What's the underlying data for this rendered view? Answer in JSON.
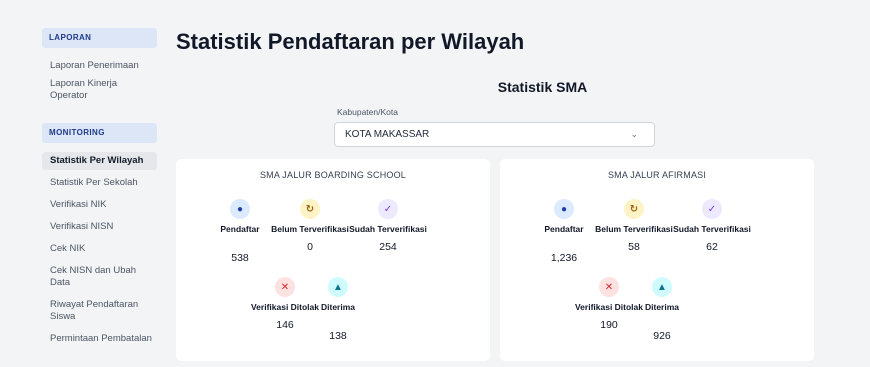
{
  "sidebar": {
    "laporan_title": "LAPORAN",
    "laporan_items": [
      "Laporan Penerimaan",
      "Laporan Kinerja Operator"
    ],
    "monitoring_title": "MONITORING",
    "monitoring_items": [
      "Statistik Per Wilayah",
      "Statistik Per Sekolah",
      "Verifikasi NIK",
      "Verifikasi NISN",
      "Cek NIK",
      "Cek NISN dan Ubah Data",
      "Riwayat Pendaftaran Siswa",
      "Permintaan Pembatalan"
    ],
    "active_item": "Statistik Per Wilayah"
  },
  "main": {
    "title": "Statistik Pendaftaran per Wilayah",
    "subtitle": "Statistik SMA",
    "kab_label": "Kabupaten/Kota",
    "kab_value": "KOTA MAKASSAR",
    "cards": [
      {
        "title": "SMA JALUR BOARDING SCHOOL",
        "pendaftar_label": "Pendaftar",
        "pendaftar": "538",
        "belum_label": "Belum Terverifikasi",
        "belum": "0",
        "sudah_label": "Sudah Terverifikasi",
        "sudah": "254",
        "ditolak_label": "Verifikasi Ditolak",
        "ditolak": "146",
        "diterima_label": "Diterima",
        "diterima": "138"
      },
      {
        "title": "SMA JALUR AFIRMASI",
        "pendaftar_label": "Pendaftar",
        "pendaftar": "1,236",
        "belum_label": "Belum Terverifikasi",
        "belum": "58",
        "sudah_label": "Sudah Terverifikasi",
        "sudah": "62",
        "ditolak_label": "Verifikasi Ditolak",
        "ditolak": "190",
        "diterima_label": "Diterima",
        "diterima": "926"
      }
    ]
  },
  "icons": {
    "pendaftar": "user-icon",
    "belum": "refresh-icon",
    "sudah": "check-icon",
    "ditolak": "x-icon",
    "diterima": "graduation-cap-icon"
  },
  "colors": {
    "sidebar_section_bg": "#dde6f7",
    "sidebar_section_text": "#1e3a8a",
    "page_bg": "#f3f4f6",
    "card_bg": "#ffffff"
  }
}
